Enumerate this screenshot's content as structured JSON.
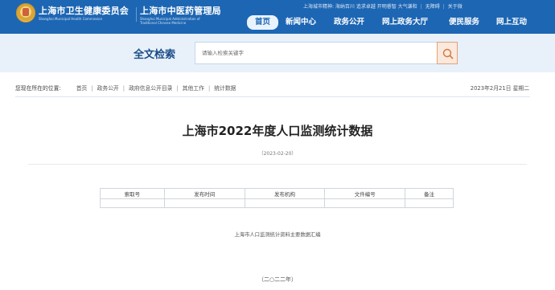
{
  "header": {
    "org1_cn": "上海市卫生健康委员会",
    "org1_en": "Shanghai Municipal Health Commission",
    "org2_cn": "上海市中医药管理局",
    "org2_en": "Shanghai Municipal Administration of",
    "org2_en2": "Traditional Chinese Medicine",
    "spirit": "上海城市精神: 海纳百川 追求卓越 开明睿智 大气谦和",
    "accessibility": "无障碍",
    "wechat": "关于微"
  },
  "nav": {
    "items": [
      "首页",
      "新闻中心",
      "政务公开",
      "网上政务大厅",
      "便民服务",
      "网上互动"
    ],
    "active_index": 0
  },
  "search": {
    "title": "全文检索",
    "placeholder": "请输入检索关键字",
    "button_icon": "search-icon"
  },
  "breadcrumb": {
    "label": "您现在所在的位置:",
    "items": [
      "首页",
      "政务公开",
      "政府信息公开目录",
      "其他工作",
      "统计数据"
    ],
    "date": "2023年2月21日 星期二"
  },
  "article": {
    "title": "上海市2022年度人口监测统计数据",
    "date": "（2023-02-20）",
    "table": {
      "headers": [
        "索取号",
        "发布时间",
        "发布机构",
        "文件编号",
        "备注"
      ],
      "values": [
        "",
        "",
        "",
        "",
        ""
      ]
    },
    "caption": "上海市人口监测统计资料主要数据汇编",
    "year": "（二○二二年）"
  },
  "colors": {
    "header_bg": "#1d66b3",
    "search_band_bg": "#e8f1fa",
    "search_button_border": "#e4a077",
    "accent": "#1a4b86"
  }
}
